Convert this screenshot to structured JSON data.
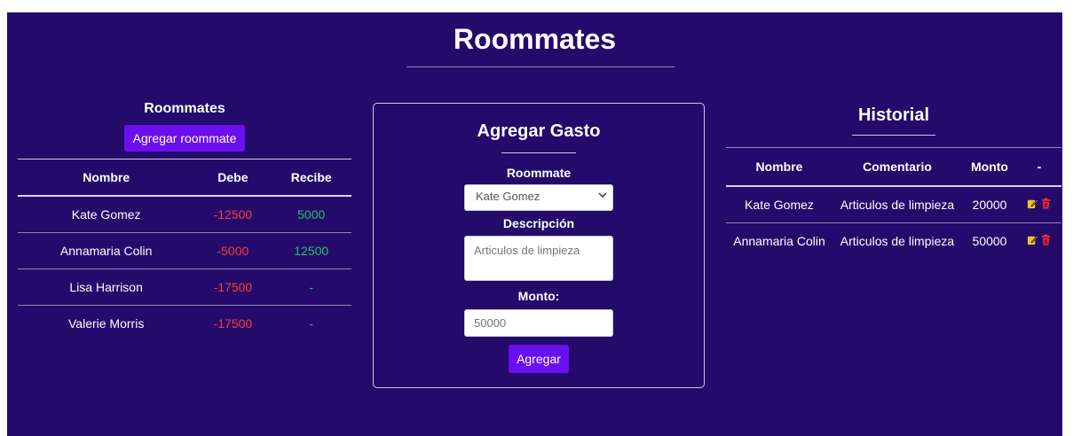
{
  "page": {
    "title": "Roommates"
  },
  "roommates_panel": {
    "heading": "Roommates",
    "add_button": "Agregar roommate",
    "columns": [
      "Nombre",
      "Debe",
      "Recibe"
    ],
    "rows": [
      {
        "name": "Kate Gomez",
        "debe": "-12500",
        "recibe": "5000"
      },
      {
        "name": "Annamaria Colin",
        "debe": "-5000",
        "recibe": "12500"
      },
      {
        "name": "Lisa Harrison",
        "debe": "-17500",
        "recibe": "-"
      },
      {
        "name": "Valerie Morris",
        "debe": "-17500",
        "recibe": "-"
      }
    ]
  },
  "gasto_form": {
    "title": "Agregar Gasto",
    "roommate_label": "Roommate",
    "roommate_selected": "Kate Gomez",
    "descripcion_label": "Descripción",
    "descripcion_placeholder": "Articulos de limpieza",
    "monto_label": "Monto:",
    "monto_placeholder": "50000",
    "submit": "Agregar"
  },
  "historial": {
    "title": "Historial",
    "columns": [
      "Nombre",
      "Comentario",
      "Monto",
      "-"
    ],
    "rows": [
      {
        "name": "Kate Gomez",
        "comentario": "Articulos de limpieza",
        "monto": "20000"
      },
      {
        "name": "Annamaria Colin",
        "comentario": "Articulos de limpieza",
        "monto": "50000"
      }
    ]
  },
  "colors": {
    "background": "#240a6b",
    "button": "#6a0ff0",
    "negative": "#ff3b3b",
    "positive": "#22c55e",
    "edit_icon": "#f5c518",
    "delete_icon": "#ff2a2a"
  },
  "icons": {
    "edit": "edit-icon",
    "delete": "trash-icon",
    "select": "chevron-down-icon"
  }
}
